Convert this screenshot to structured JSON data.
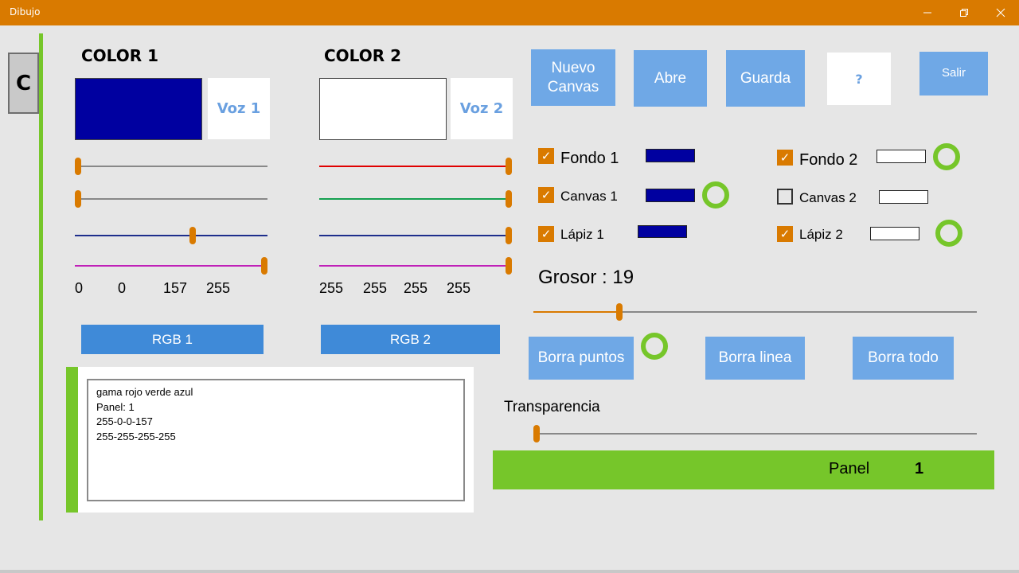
{
  "window": {
    "title": "Dibujo",
    "minimize_icon": "minimize-icon",
    "restore_icon": "restore-icon",
    "close_icon": "close-icon"
  },
  "side": {
    "c_label": "C"
  },
  "color1": {
    "heading": "COLOR 1",
    "swatch_color": "#0000a0",
    "voice_label": "Voz 1",
    "sliders": [
      {
        "value": 0,
        "color": "#888888"
      },
      {
        "value": 0,
        "color": "#888888"
      },
      {
        "value": 157,
        "color": "#1e2e8c"
      },
      {
        "value": 255,
        "color": "#c020b8"
      }
    ],
    "values": [
      "0",
      "0",
      "157",
      "255"
    ],
    "rgb_label": "RGB 1"
  },
  "color2": {
    "heading": "COLOR 2",
    "swatch_color": "#ffffff",
    "voice_label": "Voz 2",
    "sliders": [
      {
        "value": 255,
        "color": "#e00000"
      },
      {
        "value": 255,
        "color": "#14a050"
      },
      {
        "value": 255,
        "color": "#1e2e8c"
      },
      {
        "value": 255,
        "color": "#c020b8"
      }
    ],
    "values": [
      "255",
      "255",
      "255",
      "255"
    ],
    "rgb_label": "RGB 2"
  },
  "toolbar": {
    "new_canvas": "Nuevo\nCanvas",
    "open": "Abre",
    "save": "Guarda",
    "help": "?",
    "exit": "Salir"
  },
  "options": {
    "fondo1": {
      "label": "Fondo 1",
      "checked": true,
      "color": "#0000a0"
    },
    "canvas1": {
      "label": "Canvas 1",
      "checked": true,
      "color": "#0000a0"
    },
    "lapiz1": {
      "label": "Lápiz 1",
      "checked": true,
      "color": "#0000a0"
    },
    "fondo2": {
      "label": "Fondo 2",
      "checked": true,
      "color": "#ffffff"
    },
    "canvas2": {
      "label": "Canvas 2",
      "checked": false,
      "color": "#ffffff"
    },
    "lapiz2": {
      "label": "Lápiz 2",
      "checked": true,
      "color": "#ffffff"
    }
  },
  "grosor": {
    "label": "Grosor : 19",
    "value": 19,
    "max": 100
  },
  "erase": {
    "points": "Borra puntos",
    "line": "Borra linea",
    "all": "Borra todo"
  },
  "transparency": {
    "label": "Transparencia",
    "value": 0
  },
  "panel": {
    "label": "Panel",
    "number": "1"
  },
  "log": {
    "lines": [
      "gama rojo verde azul",
      "Panel: 1",
      "255-0-0-157",
      "255-255-255-255"
    ]
  },
  "colors": {
    "accent": "#d97a00",
    "green": "#76c62a",
    "button_blue": "#6fa8e6",
    "rgb_blue": "#3f8ad8"
  }
}
